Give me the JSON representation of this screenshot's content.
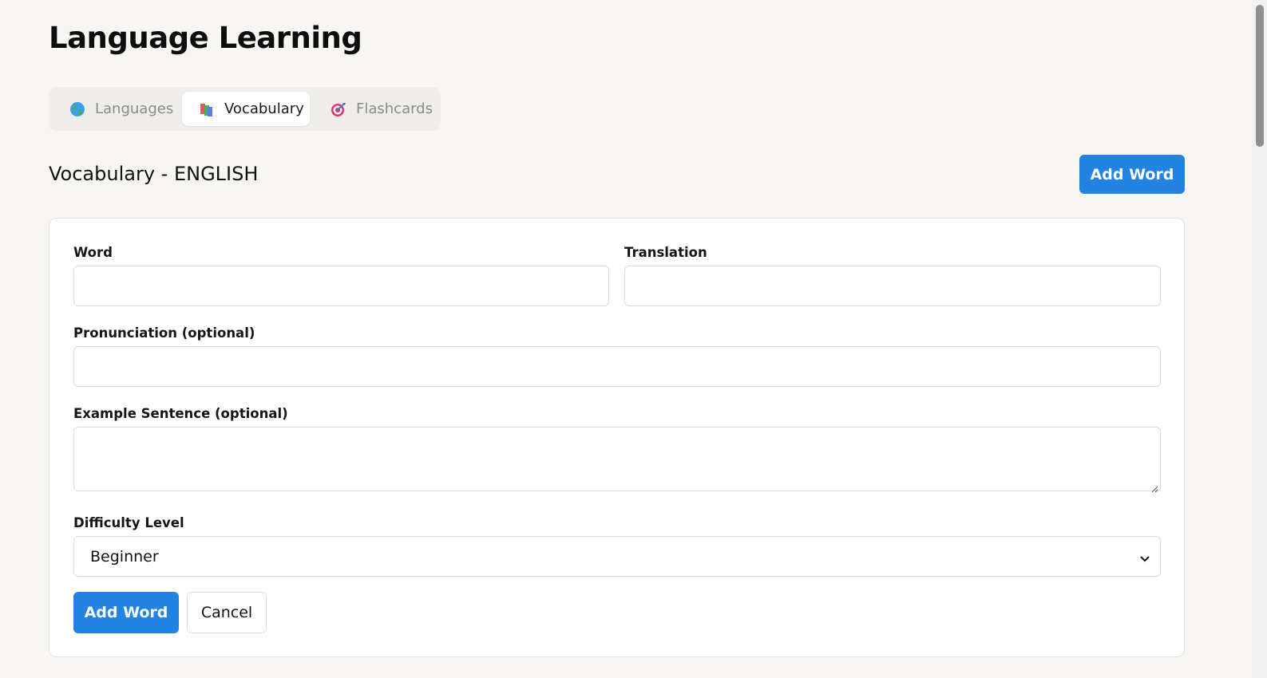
{
  "app": {
    "title": "Language Learning"
  },
  "tabs": [
    {
      "label": "Languages",
      "icon": "globe-icon",
      "active": false
    },
    {
      "label": "Vocabulary",
      "icon": "books-icon",
      "active": true
    },
    {
      "label": "Flashcards",
      "icon": "target-icon",
      "active": false
    }
  ],
  "header": {
    "title": "Vocabulary - ENGLISH",
    "add_button_label": "Add Word"
  },
  "form": {
    "word": {
      "label": "Word",
      "value": "",
      "placeholder": ""
    },
    "translation": {
      "label": "Translation",
      "value": "",
      "placeholder": ""
    },
    "pronunciation": {
      "label": "Pronunciation (optional)",
      "value": "",
      "placeholder": ""
    },
    "example": {
      "label": "Example Sentence (optional)",
      "value": "",
      "placeholder": ""
    },
    "difficulty": {
      "label": "Difficulty Level",
      "selected": "Beginner"
    },
    "submit_label": "Add Word",
    "cancel_label": "Cancel"
  },
  "colors": {
    "accent": "#2383e2",
    "background": "#f7f6f3"
  }
}
